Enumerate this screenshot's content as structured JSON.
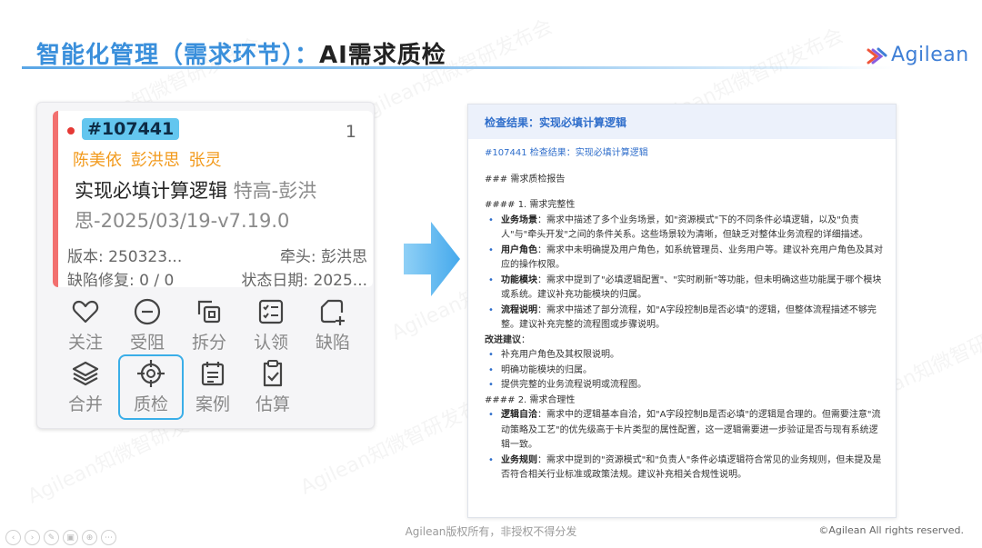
{
  "header": {
    "title_part1": "智能化管理（需求环节）：",
    "title_part2": "AI需求质检",
    "logo_text": "Agilean"
  },
  "watermark": "Agilean知微智研发布会",
  "task": {
    "id": "#107441",
    "count": "1",
    "owners": "陈美依  彭洪思  张灵",
    "title_main": "实现必填计算逻辑",
    "title_sub": " 特高-彭洪思-2025/03/19-v7.19.0",
    "version": "版本: 250323...",
    "lead": "牵头: 彭洪思",
    "defect_fix": "缺陷修复: 0 / 0",
    "status_date": "状态日期: 2025..."
  },
  "actions": [
    {
      "label": "关注",
      "icon": "heart-icon"
    },
    {
      "label": "受阻",
      "icon": "minus-circle-icon"
    },
    {
      "label": "拆分",
      "icon": "split-icon"
    },
    {
      "label": "认领",
      "icon": "checklist-icon"
    },
    {
      "label": "缺陷",
      "icon": "add-page-icon"
    },
    {
      "label": "合并",
      "icon": "layers-icon"
    },
    {
      "label": "质检",
      "icon": "crosshair-icon"
    },
    {
      "label": "案例",
      "icon": "calendar-list-icon"
    },
    {
      "label": "估算",
      "icon": "clipboard-check-icon"
    }
  ],
  "result": {
    "header": "检查结果：实现必填计算逻辑",
    "subtitle": "#107441 检查结果：实现必填计算逻辑",
    "report_title": "### 需求质检报告",
    "section1": "#### 1. 需求完整性",
    "section1_items": [
      {
        "term": "业务场景",
        "text": "：需求中描述了多个业务场景，如\"资源模式\"下的不同条件必填逻辑，以及\"负责人\"与\"牵头开发\"之间的条件关系。这些场景较为清晰，但缺乏对整体业务流程的详细描述。"
      },
      {
        "term": "用户角色",
        "text": "：需求中未明确提及用户角色，如系统管理员、业务用户等。建议补充用户角色及其对应的操作权限。"
      },
      {
        "term": "功能模块",
        "text": "：需求中提到了\"必填逻辑配置\"、\"实时刷新\"等功能，但未明确这些功能属于哪个模块或系统。建议补充功能模块的归属。"
      },
      {
        "term": "流程说明",
        "text": "：需求中描述了部分流程，如\"A字段控制B是否必填\"的逻辑，但整体流程描述不够完整。建议补充完整的流程图或步骤说明。"
      }
    ],
    "improve_title": "改进建议",
    "improve_colon": "：",
    "improve_items": [
      "补充用户角色及其权限说明。",
      "明确功能模块的归属。",
      "提供完整的业务流程说明或流程图。"
    ],
    "section2": "#### 2. 需求合理性",
    "section2_items": [
      {
        "term": "逻辑自洽",
        "text": "：需求中的逻辑基本自洽，如\"A字段控制B是否必填\"的逻辑是合理的。但需要注意\"流动策略及工艺\"的优先级高于卡片类型的属性配置，这一逻辑需要进一步验证是否与现有系统逻辑一致。"
      },
      {
        "term": "业务规则",
        "text": "：需求中提到的\"资源模式\"和\"负责人\"条件必填逻辑符合常见的业务规则，但未提及是否符合相关行业标准或政策法规。建议补充相关合规性说明。"
      }
    ]
  },
  "footer": {
    "center": "Agilean版权所有，非授权不得分发",
    "right": "©Agilean All rights reserved."
  },
  "colors": {
    "title_blue": "#3a8fdb",
    "id_badge": "#63c6ef",
    "owner_orange": "#f29a1c",
    "priority_bar": "#f2706f",
    "selected_outline": "#3aaee8",
    "arrow": "#55b4ee"
  }
}
